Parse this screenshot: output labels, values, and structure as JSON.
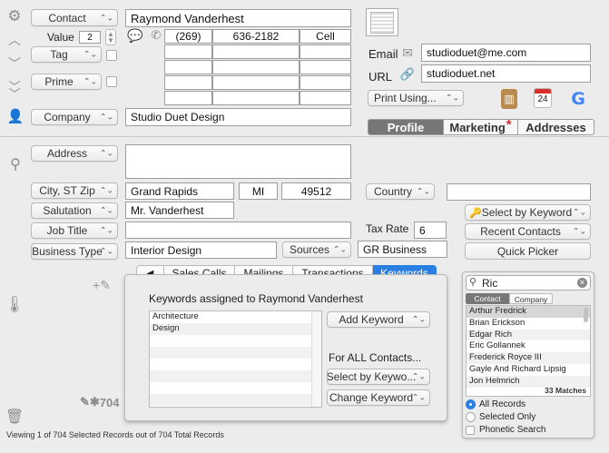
{
  "contact_header": {
    "contact_popup": "Contact",
    "contact_name": "Raymond Vanderhest",
    "value_label": "Value",
    "value_input": "2",
    "tag_popup": "Tag",
    "prime_popup": "Prime",
    "company_popup": "Company",
    "company_name": "Studio Duet Design"
  },
  "phones": [
    {
      "area": "(269)",
      "number": "636-2182",
      "type": "Cell"
    },
    {
      "area": "",
      "number": "",
      "type": ""
    },
    {
      "area": "",
      "number": "",
      "type": ""
    },
    {
      "area": "",
      "number": "",
      "type": ""
    },
    {
      "area": "",
      "number": "",
      "type": ""
    }
  ],
  "right_panel": {
    "email_label": "Email",
    "email_value": "studioduet@me.com",
    "url_label": "URL",
    "url_value": "studioduet.net",
    "print_popup": "Print Using...",
    "tabs": [
      "Profile",
      "Marketing",
      "Addresses"
    ],
    "marketing_mark": "*"
  },
  "address": {
    "address_popup": "Address",
    "address_value": "",
    "city_popup": "City, ST Zip",
    "city": "Grand Rapids",
    "state": "MI",
    "zip": "49512",
    "country_popup": "Country",
    "country_value": "",
    "salutation_popup": "Salutation",
    "salutation": "Mr. Vanderhest",
    "job_title_popup": "Job Title",
    "job_title": "",
    "tax_rate_label": "Tax Rate",
    "tax_rate": "6",
    "business_type_popup": "Business Type",
    "business_type": "Interior Design",
    "sources_popup": "Sources",
    "sources": "GR Business"
  },
  "side_buttons": {
    "select_by_keyword": "Select by Keyword",
    "recent_contacts": "Recent Contacts",
    "quick_picker": "Quick Picker"
  },
  "subtabs": {
    "back": "◀",
    "items": [
      "Sales Calls",
      "Mailings",
      "Transactions",
      "Keywords"
    ]
  },
  "keywords": {
    "heading": "Keywords assigned to Raymond Vanderhest",
    "list": [
      "Architecture",
      "Design",
      "",
      "",
      "",
      "",
      "",
      ""
    ],
    "add_keyword": "Add Keyword",
    "for_all": "For ALL Contacts...",
    "select_by_keyword": "Select by Keywo...",
    "change_keyword": "Change Keyword"
  },
  "left_tools": {
    "edit_count": "704"
  },
  "search": {
    "query": "Ric",
    "tabs": [
      "Contact",
      "Company"
    ],
    "results": [
      "Arthur Fredrick",
      "Brian Erickson",
      "Edgar Rich",
      "Eric Gollannek",
      "Frederick Royce III",
      "Gayle And Richard Lipsig",
      "Jon Helmrich"
    ],
    "matches": "33 Matches",
    "options": [
      "All Records",
      "Selected Only",
      "Phonetic Search"
    ]
  },
  "calendar_day": "24",
  "status": "Viewing 1 of 704 Selected Records out of 704 Total Records",
  "colors": {
    "accent": "#2a7fe3",
    "marketing_star": "#d9302c",
    "active_tab": "#777777"
  }
}
